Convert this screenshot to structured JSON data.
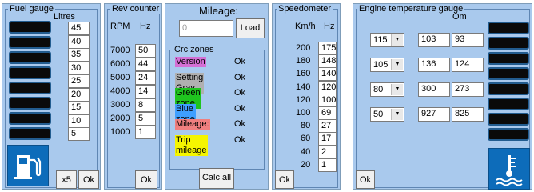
{
  "fuel": {
    "title": "Fuel gauge",
    "unit": "Litres",
    "values": [
      "45",
      "40",
      "35",
      "30",
      "25",
      "20",
      "15",
      "10",
      "5"
    ],
    "x5_label": "x5",
    "ok_label": "Ok",
    "icon": "fuel-pump-icon"
  },
  "rev": {
    "title": "Rev counter",
    "rpm_label": "RPM",
    "hz_label": "Hz",
    "rpm": [
      "7000",
      "6000",
      "5000",
      "4000",
      "3000",
      "2000",
      "1000"
    ],
    "hz": [
      "50",
      "44",
      "24",
      "14",
      "8",
      "5",
      "1"
    ],
    "ok_label": "Ok"
  },
  "mileage": {
    "title": "Mileage:",
    "value": "0",
    "load_label": "Load"
  },
  "crc": {
    "title": "Crc zones",
    "zones": [
      {
        "name": "Version",
        "status": "Ok",
        "color": "#d46fd4"
      },
      {
        "name": "Setting Gray",
        "status": "Ok",
        "color": "#b0b0b0"
      },
      {
        "name": "Green zone",
        "status": "Ok",
        "color": "#1fc41f"
      },
      {
        "name": "Blue zone",
        "status": "Ok",
        "color": "#3f9fff"
      },
      {
        "name": "Mileage:",
        "status": "Ok",
        "color": "#f07f7f"
      },
      {
        "name": "Trip mileage",
        "status": "Ok",
        "color": "#f5f500"
      }
    ],
    "calc_label": "Calc all"
  },
  "speedo": {
    "title": "Speedometer",
    "kmh_label": "Km/h",
    "hz_label": "Hz",
    "kmh": [
      "200",
      "180",
      "160",
      "140",
      "120",
      "100",
      "80",
      "60",
      "40",
      "20"
    ],
    "hz": [
      "175",
      "148",
      "140",
      "120",
      "100",
      "69",
      "27",
      "17",
      "2",
      "1"
    ],
    "ok_label": "Ok"
  },
  "engine": {
    "title": "Engine temperature gauge",
    "om_label": "Om",
    "rows": [
      {
        "temp": "115",
        "v1": "103",
        "v2": "93"
      },
      {
        "temp": "105",
        "v1": "136",
        "v2": "124"
      },
      {
        "temp": "80",
        "v1": "300",
        "v2": "273"
      },
      {
        "temp": "50",
        "v1": "927",
        "v2": "825"
      }
    ],
    "ok_label": "Ok",
    "icon": "coolant-temperature-icon"
  },
  "colors": {
    "panel": "#a9c9ed",
    "icon_bg": "#0d6cba",
    "segment": "#0a0a0a"
  }
}
